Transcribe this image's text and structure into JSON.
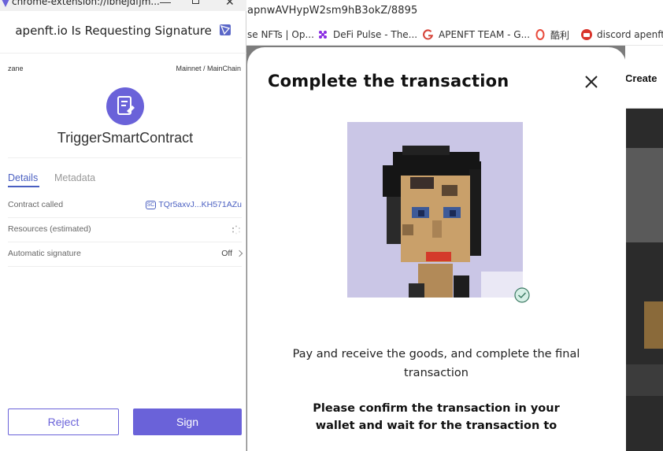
{
  "browser": {
    "url": "apnwAVHypW2sm9hB3okZ/8895",
    "bookmarks": [
      {
        "label": "se NFTs | Op...",
        "icon": "opensea-icon"
      },
      {
        "label": "DeFi Pulse - The...",
        "icon": "defi-pulse-icon"
      },
      {
        "label": "APENFT TEAM - G...",
        "icon": "google-icon"
      },
      {
        "label": "酷利",
        "icon": "kuli-icon"
      },
      {
        "label": "discord apenft",
        "icon": "discord-site-icon"
      }
    ],
    "create_label": "Create"
  },
  "modal": {
    "title": "Complete the transaction",
    "description": "Pay and receive the goods, and complete the final transaction",
    "confirm_line1": "Please confirm the transaction in your",
    "confirm_line2": "wallet and wait for the transaction to"
  },
  "popup": {
    "window_title": "chrome-extension://ibnejdfjm...",
    "header": "apenft.io Is Requesting Signature",
    "account": "zane",
    "network": "Mainnet / MainChain",
    "contract_type": "TriggerSmartContract",
    "tabs": {
      "details": "Details",
      "metadata": "Metadata"
    },
    "rows": {
      "contract_called_label": "Contract called",
      "contract_called_badge": "SC",
      "contract_called_value": "TQr5axvJ...KH571AZu",
      "resources_label": "Resources (estimated)",
      "auto_sign_label": "Automatic signature",
      "auto_sign_value": "Off"
    },
    "reject_label": "Reject",
    "sign_label": "Sign"
  },
  "colors": {
    "accent": "#6a62d9",
    "link": "#4a5fc1",
    "nft_bg": "#cac6e6"
  }
}
